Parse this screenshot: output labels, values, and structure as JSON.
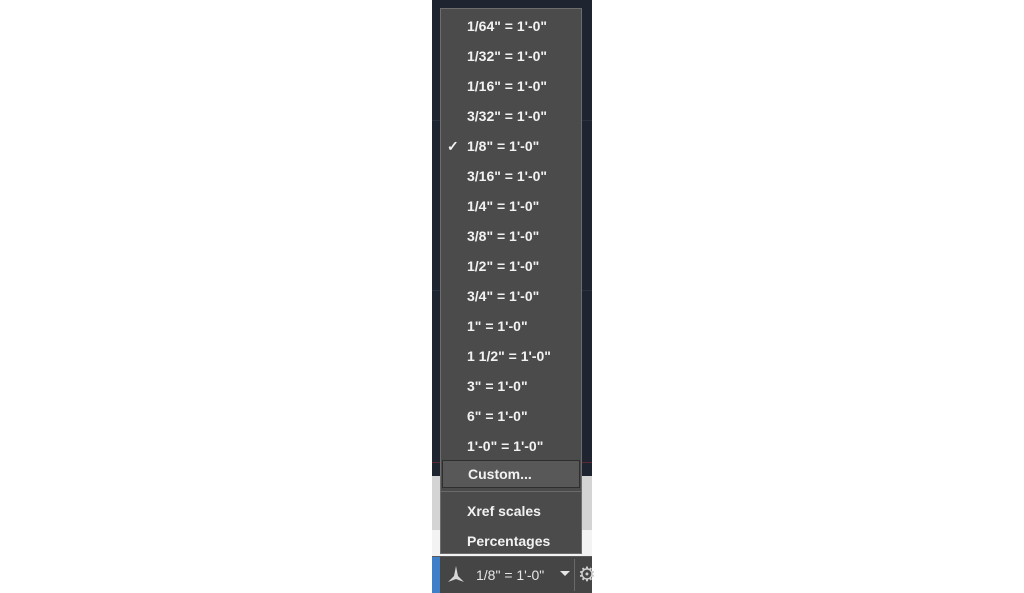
{
  "scale_menu": {
    "items": [
      {
        "label": "1/64\" = 1'-0\"",
        "checked": false
      },
      {
        "label": "1/32\" = 1'-0\"",
        "checked": false
      },
      {
        "label": "1/16\" = 1'-0\"",
        "checked": false
      },
      {
        "label": "3/32\" = 1'-0\"",
        "checked": false
      },
      {
        "label": "1/8\" = 1'-0\"",
        "checked": true
      },
      {
        "label": "3/16\" = 1'-0\"",
        "checked": false
      },
      {
        "label": "1/4\" = 1'-0\"",
        "checked": false
      },
      {
        "label": "3/8\" = 1'-0\"",
        "checked": false
      },
      {
        "label": "1/2\" = 1'-0\"",
        "checked": false
      },
      {
        "label": "3/4\" = 1'-0\"",
        "checked": false
      },
      {
        "label": "1\" = 1'-0\"",
        "checked": false
      },
      {
        "label": "1 1/2\" = 1'-0\"",
        "checked": false
      },
      {
        "label": "3\" = 1'-0\"",
        "checked": false
      },
      {
        "label": "6\" = 1'-0\"",
        "checked": false
      },
      {
        "label": "1'-0\" = 1'-0\"",
        "checked": false
      }
    ],
    "check_glyph": "✓",
    "custom_label": "Custom...",
    "xref_label": "Xref scales",
    "percentages_label": "Percentages"
  },
  "statusbar": {
    "current_scale": "1/8\" = 1'-0\"",
    "annotation_icon": "annotation-scale-icon",
    "settings_icon": "gear-icon"
  }
}
